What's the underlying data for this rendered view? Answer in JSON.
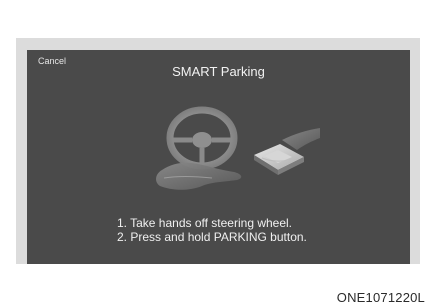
{
  "screen": {
    "cancel_label": "Cancel",
    "title": "SMART Parking",
    "instructions": [
      "1. Take hands off steering wheel.",
      "2. Press and hold PARKING button."
    ]
  },
  "footer": {
    "code": "ONE1071220L"
  },
  "colors": {
    "screen_bg": "#4a4a4a",
    "frame_bg": "#dcdcdc",
    "text": "#f0f0f0"
  },
  "icons": {
    "steering": "steering-wheel-icon",
    "hand": "hand-icon",
    "parking_button": "parking-button-icon"
  }
}
